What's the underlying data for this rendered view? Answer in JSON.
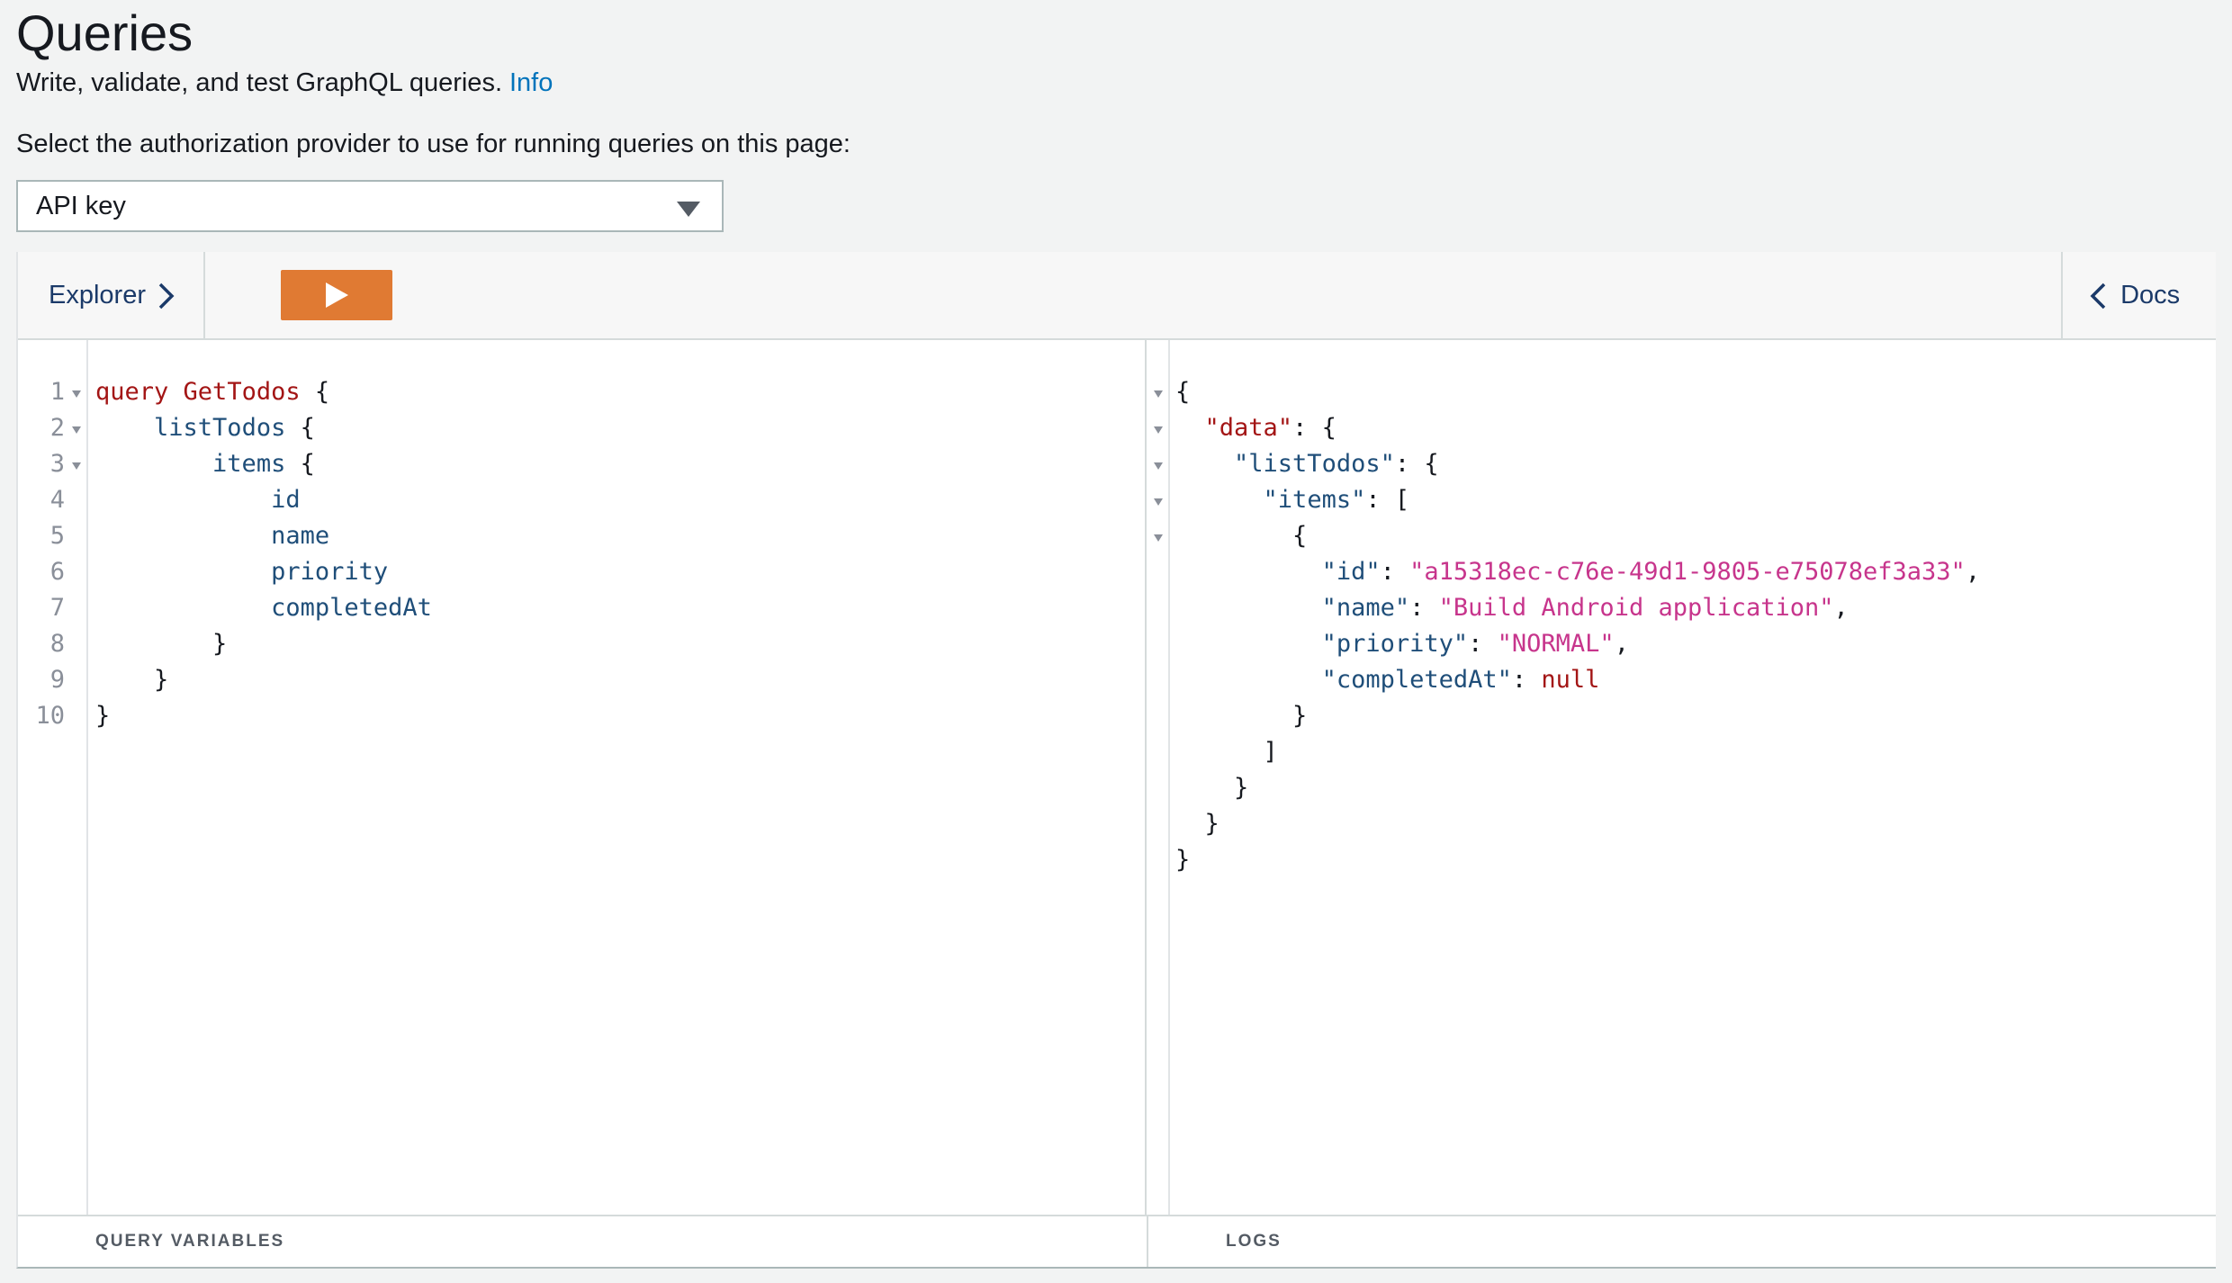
{
  "page": {
    "title": "Queries",
    "description": "Write, validate, and test GraphQL queries.",
    "info_link": "Info",
    "auth_label": "Select the authorization provider to use for running queries on this page:",
    "auth_selected": "API key"
  },
  "toolbar": {
    "explorer_label": "Explorer",
    "docs_label": "Docs",
    "run_button_color": "#e07a33"
  },
  "query_editor": {
    "line_numbers": [
      "1",
      "2",
      "3",
      "4",
      "5",
      "6",
      "7",
      "8",
      "9",
      "10"
    ],
    "query_keyword": "query",
    "operation_name": "GetTodos",
    "root_field": "listTodos",
    "items_field": "items",
    "fields": [
      "id",
      "name",
      "priority",
      "completedAt"
    ]
  },
  "result": {
    "data_key": "\"data\"",
    "list_key": "\"listTodos\"",
    "items_key": "\"items\"",
    "id_key": "\"id\"",
    "id_value": "\"a15318ec-c76e-49d1-9805-e75078ef3a33\"",
    "name_key": "\"name\"",
    "name_value": "\"Build Android application\"",
    "priority_key": "\"priority\"",
    "priority_value": "\"NORMAL\"",
    "completed_key": "\"completedAt\"",
    "completed_value": "null"
  },
  "footer": {
    "query_variables": "QUERY VARIABLES",
    "logs": "LOGS"
  },
  "colors": {
    "accent": "#e07a33",
    "link": "#0073bb",
    "keyword": "#a31515",
    "field": "#1f4e79",
    "string": "#c7358c"
  }
}
